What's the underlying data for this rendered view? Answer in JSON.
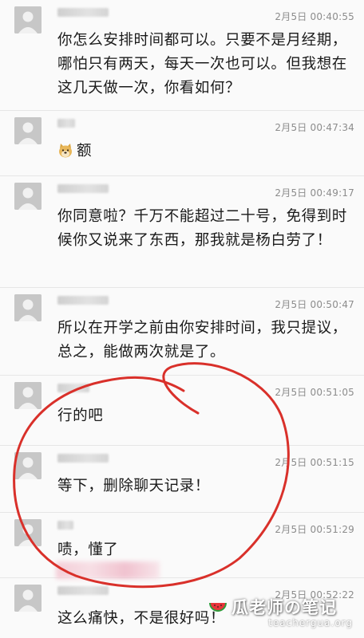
{
  "messages": [
    {
      "time": "2月5日 00:40:55",
      "text": "你怎么安排时间都可以。只要不是月经期，哪怕只有两天，每天一次也可以。但我想在这几天做一次，你看如何？"
    },
    {
      "time": "2月5日 00:47:34",
      "text": "额",
      "emoji": "doge-face-icon"
    },
    {
      "time": "2月5日 00:49:17",
      "text": "你同意啦？千万不能超过二十号，免得到时候你又说来了东西，那我就是杨白劳了！"
    },
    {
      "time": "2月5日 00:50:47",
      "text": "所以在开学之前由你安排时间，我只提议，总之，能做两次就是了。"
    },
    {
      "time": "2月5日 00:51:05",
      "text": "行的吧"
    },
    {
      "time": "2月5日 00:51:15",
      "text": "等下，删除聊天记录！"
    },
    {
      "time": "2月5日 00:51:29",
      "text": "啧，懂了"
    },
    {
      "time": "2月5日 00:52:22",
      "text": "这么痛快，不是很好吗！"
    }
  ],
  "watermark": {
    "title": "瓜老师の笔记",
    "url": "teachergua.org",
    "icon": "watermelon-icon"
  },
  "annotation": {
    "shape": "hand-drawn-circle",
    "color": "#d9302a"
  }
}
